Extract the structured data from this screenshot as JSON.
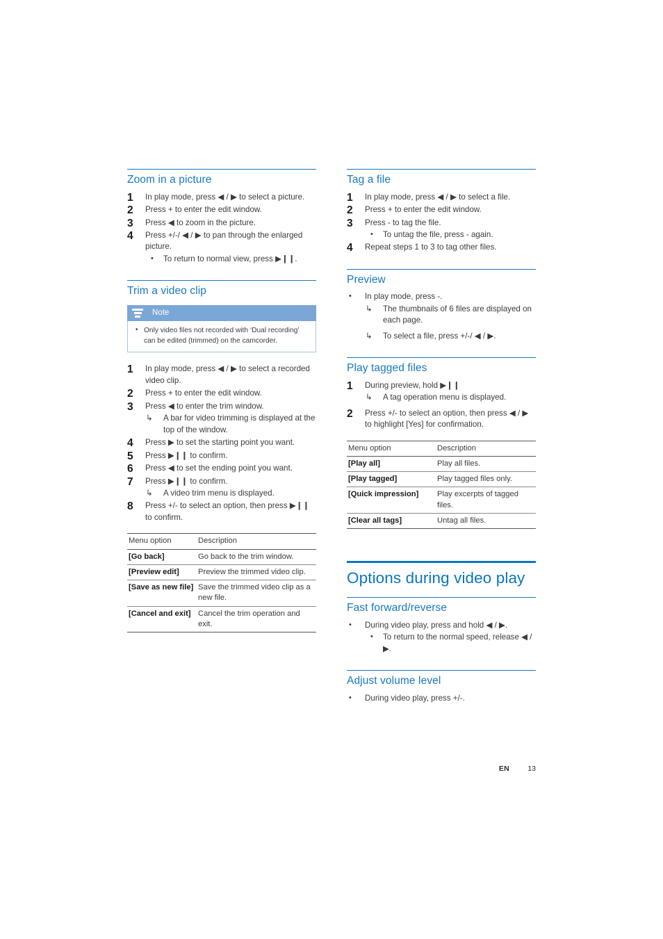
{
  "document": {
    "footer": {
      "language": "EN",
      "page_number": "13"
    }
  },
  "left_column": {
    "sections": [
      {
        "id": "zoom-in-a-picture",
        "heading": "Zoom in a picture",
        "steps": [
          {
            "num": "1",
            "text": "In play mode, press ◀ / ▶ to select a picture."
          },
          {
            "num": "2",
            "text": "Press + to enter the edit window."
          },
          {
            "num": "3",
            "text": "Press ◀ to zoom in the picture."
          },
          {
            "num": "4",
            "text": "Press +/-/ ◀ / ▶ to pan through the enlarged picture.",
            "bullet": "To return to normal view, press ▶❙❙."
          }
        ]
      },
      {
        "id": "trim-a-video-clip",
        "heading": "Trim a video clip",
        "note": {
          "title": "Note",
          "text": "Only video files not recorded with ‘Dual recording’ can be edited (trimmed) on the camcorder."
        },
        "steps": [
          {
            "num": "1",
            "text": "In play mode, press ◀ / ▶ to select a recorded video clip."
          },
          {
            "num": "2",
            "text": "Press + to enter the edit window."
          },
          {
            "num": "3",
            "text": "Press ◀ to enter the trim window.",
            "result": "A bar for video trimming is displayed at the top of the window."
          },
          {
            "num": "4",
            "text": "Press ▶ to set the starting point you want."
          },
          {
            "num": "5",
            "text": "Press ▶❙❙ to confirm."
          },
          {
            "num": "6",
            "text": "Press ◀ to set the ending point you want."
          },
          {
            "num": "7",
            "text": "Press ▶❙❙ to confirm.",
            "result": "A video trim menu is displayed."
          },
          {
            "num": "8",
            "text": "Press +/- to select an option, then press ▶❙❙ to confirm."
          }
        ],
        "table": {
          "headers": [
            "Menu option",
            "Description"
          ],
          "rows": [
            [
              "[Go back]",
              "Go back to the trim window."
            ],
            [
              "[Preview edit]",
              "Preview the trimmed video clip."
            ],
            [
              "[Save as new file]",
              "Save the trimmed video clip as a new file."
            ],
            [
              "[Cancel and exit]",
              "Cancel the trim operation and exit."
            ]
          ]
        }
      }
    ]
  },
  "right_column": {
    "sections": [
      {
        "id": "tag-a-file",
        "heading": "Tag a file",
        "steps": [
          {
            "num": "1",
            "text": "In play mode, press ◀ / ▶ to select a file."
          },
          {
            "num": "2",
            "text": "Press + to enter the edit window."
          },
          {
            "num": "3",
            "text": "Press - to tag the file.",
            "bullet": "To untag the file, press - again."
          },
          {
            "num": "4",
            "text": "Repeat steps 1 to 3 to tag other files."
          }
        ]
      },
      {
        "id": "preview",
        "heading": "Preview",
        "bullets": [
          {
            "text": "In play mode, press -.",
            "results": [
              "The thumbnails of 6 files are displayed on each page.",
              "To select a file, press +/-/ ◀ / ▶."
            ]
          }
        ]
      },
      {
        "id": "play-tagged-files",
        "heading": "Play tagged files",
        "steps": [
          {
            "num": "1",
            "text": "During preview, hold ▶❙❙",
            "result": "A tag operation menu is displayed."
          },
          {
            "num": "2",
            "text": "Press +/- to select an option, then press ◀ / ▶ to highlight [Yes] for confirmation."
          }
        ],
        "table": {
          "headers": [
            "Menu option",
            "Description"
          ],
          "rows": [
            [
              "[Play all]",
              "Play all files."
            ],
            [
              "[Play tagged]",
              "Play tagged files only."
            ],
            [
              "[Quick impression]",
              "Play excerpts of tagged files."
            ],
            [
              "[Clear all tags]",
              "Untag all files."
            ]
          ]
        }
      },
      {
        "id": "options-during-video-play",
        "main_heading": "Options during video play",
        "subsections": [
          {
            "id": "fast-forward-reverse",
            "heading": "Fast forward/reverse",
            "bullets": [
              {
                "text": "During video play, press and hold ◀ / ▶.",
                "subbullet": "To return to the normal speed, release ◀ / ▶."
              }
            ]
          },
          {
            "id": "adjust-volume-level",
            "heading": "Adjust volume level",
            "bullets": [
              {
                "text": "During video play, press +/-."
              }
            ]
          }
        ]
      }
    ]
  },
  "colors": {
    "heading_blue": "#1878be",
    "main_heading_blue": "#0a76c0",
    "note_header_blue": "#7ba7d7",
    "note_border": "#a9c4e0",
    "body_text": "#3b3b3b"
  }
}
